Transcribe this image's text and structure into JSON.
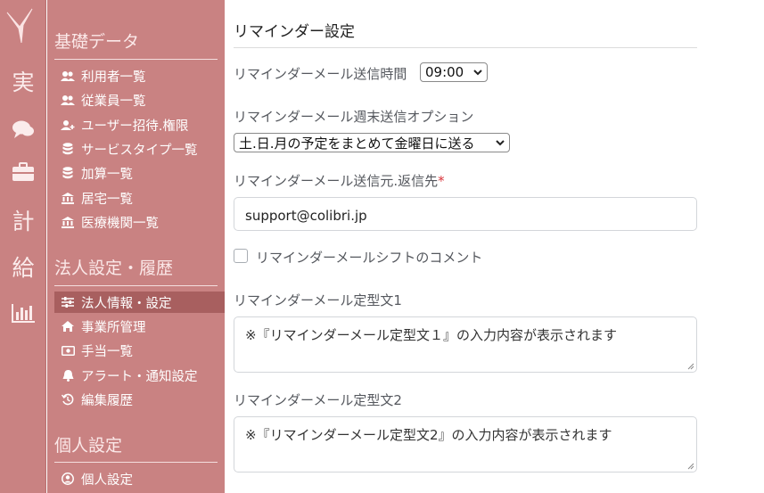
{
  "rail": {
    "items": [
      {
        "name": "shift-nav",
        "text": "実"
      },
      {
        "name": "chat-nav",
        "icon": "chat-icon"
      },
      {
        "name": "work-nav",
        "icon": "briefcase-icon"
      },
      {
        "name": "plan-nav",
        "text": "計"
      },
      {
        "name": "salary-nav",
        "text": "給"
      },
      {
        "name": "report-nav",
        "icon": "bar-chart-icon"
      }
    ]
  },
  "sidebar": {
    "sections": [
      {
        "title": "基礎データ",
        "items": [
          {
            "label": "利用者一覧",
            "icon": "users-icon"
          },
          {
            "label": "従業員一覧",
            "icon": "users-icon"
          },
          {
            "label": "ユーザー招待.権限",
            "icon": "user-plus-icon"
          },
          {
            "label": "サービスタイプ一覧",
            "icon": "database-icon"
          },
          {
            "label": "加算一覧",
            "icon": "database-icon"
          },
          {
            "label": "居宅一覧",
            "icon": "bank-icon"
          },
          {
            "label": "医療機関一覧",
            "icon": "bank-icon"
          }
        ]
      },
      {
        "title": "法人設定・履歴",
        "items": [
          {
            "label": "法人情報・設定",
            "icon": "sliders-icon",
            "active": true
          },
          {
            "label": "事業所管理",
            "icon": "home-icon"
          },
          {
            "label": "手当一覧",
            "icon": "money-icon"
          },
          {
            "label": "アラート・通知設定",
            "icon": "bell-icon"
          },
          {
            "label": "編集履歴",
            "icon": "history-icon"
          }
        ]
      },
      {
        "title": "個人設定",
        "items": [
          {
            "label": "個人設定",
            "icon": "user-circle-icon"
          }
        ]
      }
    ]
  },
  "main": {
    "title": "リマインダー設定",
    "send_time_label": "リマインダーメール送信時間",
    "send_time_value": "09:00",
    "weekend_label": "リマインダーメール週末送信オプション",
    "weekend_value": "土.日.月の予定をまとめて金曜日に送る",
    "reply_label": "リマインダーメール送信元.返信先",
    "reply_required_mark": "*",
    "reply_value": "support@colibri.jp",
    "shift_comment_label": "リマインダーメールシフトのコメント",
    "template1_label": "リマインダーメール定型文1",
    "template1_value": "※『リマインダーメール定型文１』の入力内容が表示されます",
    "template2_label": "リマインダーメール定型文2",
    "template2_value": "※『リマインダーメール定型文2』の入力内容が表示されます"
  },
  "colors": {
    "sidebar_bg": "#c98282",
    "active_bg": "#a85f5f",
    "required": "#d9333a"
  }
}
